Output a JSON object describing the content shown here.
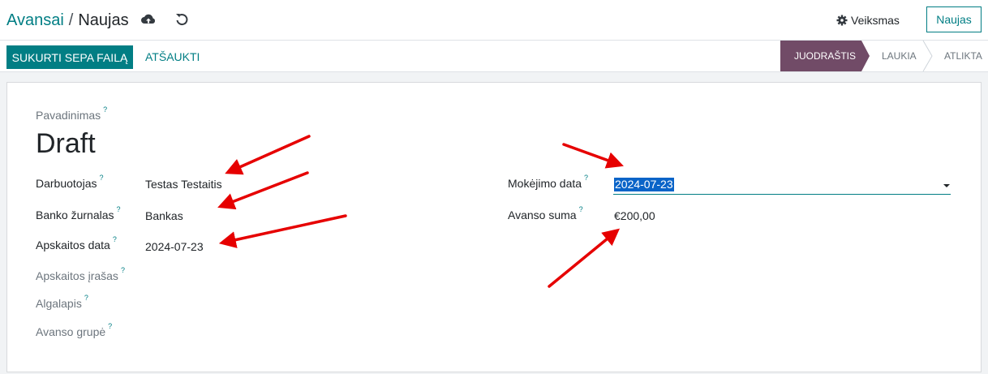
{
  "breadcrumb": {
    "parent": "Avansai",
    "separator": "/",
    "current": "Naujas"
  },
  "header": {
    "action_label": "Veiksmas",
    "new_label": "Naujas"
  },
  "controls": {
    "primary_label": "SUKURTI SEPA FAILĄ",
    "cancel_label": "ATŠAUKTI"
  },
  "status": {
    "stages": [
      "JUODRAŠTIS",
      "LAUKIA",
      "ATLIKTA"
    ],
    "active": "JUODRAŠTIS"
  },
  "form": {
    "name_label": "Pavadinimas",
    "name_value": "Draft",
    "help_mark": "?",
    "left_fields": [
      {
        "label": "Darbuotojas",
        "value": "Testas Testaitis"
      },
      {
        "label": "Banko žurnalas",
        "value": "Bankas"
      },
      {
        "label": "Apskaitos data",
        "value": "2024-07-23"
      },
      {
        "label": "Apskaitos įrašas",
        "value": ""
      },
      {
        "label": "Algalapis",
        "value": ""
      },
      {
        "label": "Avanso grupė",
        "value": ""
      }
    ],
    "right_fields": [
      {
        "label": "Mokėjimo data",
        "value": "2024-07-23"
      },
      {
        "label": "Avanso suma",
        "value": "€200,00"
      }
    ]
  },
  "colors": {
    "brand": "#017e84",
    "stage_active": "#714b67",
    "annotation": "#e60000"
  }
}
